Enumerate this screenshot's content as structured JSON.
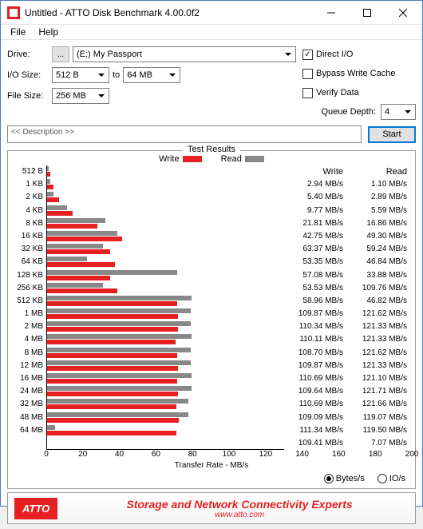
{
  "window": {
    "title": "Untitled - ATTO Disk Benchmark 4.00.0f2"
  },
  "menu": {
    "file": "File",
    "help": "Help"
  },
  "labels": {
    "drive": "Drive:",
    "iosize": "I/O Size:",
    "filesize": "File Size:",
    "to": "to",
    "queuedepth": "Queue Depth:",
    "description": "<< Description >>",
    "start": "Start",
    "testresults": "Test Results",
    "write": "Write",
    "read": "Read",
    "xaxis": "Transfer Rate - MB/s",
    "bytes_s": "Bytes/s",
    "io_s": "IO/s",
    "browse": "..."
  },
  "options": {
    "direct_io": {
      "label": "Direct I/O",
      "checked": true
    },
    "bypass": {
      "label": "Bypass Write Cache",
      "checked": false
    },
    "verify": {
      "label": "Verify Data",
      "checked": false
    }
  },
  "values": {
    "drive": "(E:) My Passport",
    "iosize_from": "512 B",
    "iosize_to": "64 MB",
    "filesize": "256 MB",
    "queuedepth": "4"
  },
  "footer": {
    "brand": "ATTO",
    "tagline": "Storage and Network Connectivity Experts",
    "url": "www.atto.com"
  },
  "chart_data": {
    "type": "bar",
    "xlabel": "Transfer Rate - MB/s",
    "xlim": [
      0,
      200
    ],
    "xticks": [
      0,
      20,
      40,
      60,
      80,
      100,
      120,
      140,
      160,
      180,
      200
    ],
    "categories": [
      "512 B",
      "1 KB",
      "2 KB",
      "4 KB",
      "8 KB",
      "16 KB",
      "32 KB",
      "64 KB",
      "128 KB",
      "256 KB",
      "512 KB",
      "1 MB",
      "2 MB",
      "4 MB",
      "8 MB",
      "12 MB",
      "16 MB",
      "24 MB",
      "32 MB",
      "48 MB",
      "64 MB"
    ],
    "series": [
      {
        "name": "Write",
        "values": [
          2.94,
          5.4,
          9.77,
          21.81,
          42.75,
          63.37,
          53.35,
          57.08,
          53.53,
          58.96,
          109.87,
          110.34,
          110.11,
          108.7,
          109.87,
          110.69,
          109.64,
          110.69,
          109.09,
          111.34,
          109.41
        ]
      },
      {
        "name": "Read",
        "values": [
          1.1,
          2.89,
          5.59,
          16.86,
          49.3,
          59.24,
          46.84,
          33.88,
          109.76,
          46.82,
          121.62,
          121.33,
          121.33,
          121.62,
          121.33,
          121.1,
          121.71,
          121.66,
          119.07,
          119.5,
          7.07
        ]
      }
    ],
    "write_col": [
      "2.94 MB/s",
      "5.40 MB/s",
      "9.77 MB/s",
      "21.81 MB/s",
      "42.75 MB/s",
      "63.37 MB/s",
      "53.35 MB/s",
      "57.08 MB/s",
      "53.53 MB/s",
      "58.96 MB/s",
      "109.87 MB/s",
      "110.34 MB/s",
      "110.11 MB/s",
      "108.70 MB/s",
      "109.87 MB/s",
      "110.69 MB/s",
      "109.64 MB/s",
      "110.69 MB/s",
      "109.09 MB/s",
      "111.34 MB/s",
      "109.41 MB/s"
    ],
    "read_col": [
      "1.10 MB/s",
      "2.89 MB/s",
      "5.59 MB/s",
      "16.86 MB/s",
      "49.30 MB/s",
      "59.24 MB/s",
      "46.84 MB/s",
      "33.88 MB/s",
      "109.76 MB/s",
      "46.82 MB/s",
      "121.62 MB/s",
      "121.33 MB/s",
      "121.33 MB/s",
      "121.62 MB/s",
      "121.33 MB/s",
      "121.10 MB/s",
      "121.71 MB/s",
      "121.66 MB/s",
      "119.07 MB/s",
      "119.50 MB/s",
      "7.07 MB/s"
    ]
  }
}
